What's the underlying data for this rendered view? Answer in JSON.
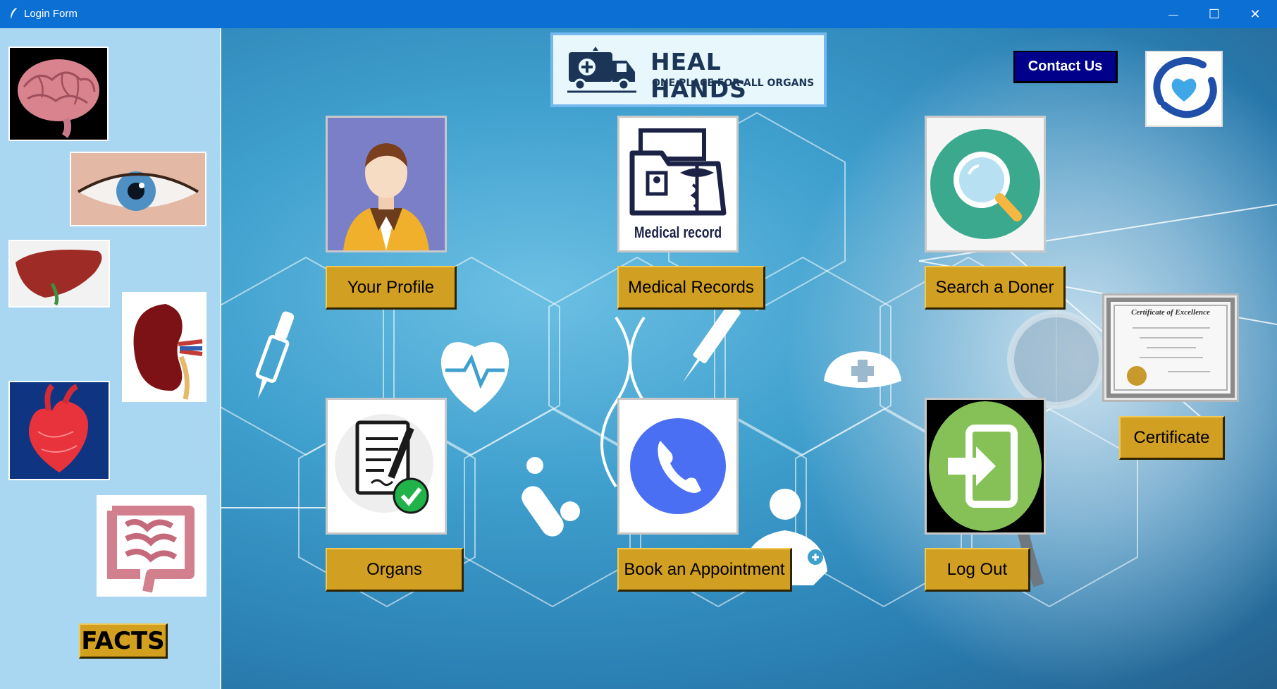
{
  "window": {
    "title": "Login Form",
    "minimize_glyph": "—",
    "maximize_glyph": "☐",
    "close_glyph": "✕"
  },
  "logo": {
    "title": "HEAL HANDS",
    "subtitle": "ONE PLACE FOR ALL ORGANS"
  },
  "header": {
    "contact_label": "Contact Us"
  },
  "sidebar": {
    "organs": [
      "brain",
      "eye",
      "liver",
      "kidney",
      "heart",
      "intestines"
    ],
    "facts_label": "FACTS"
  },
  "tiles": {
    "profile_label": "Your Profile",
    "records_label": "Medical Records",
    "records_caption": "Medical record",
    "search_label": "Search a Doner",
    "organs_label": "Organs",
    "appointment_label": "Book an Appointment",
    "logout_label": "Log Out",
    "certificate_label": "Certificate",
    "certificate_heading": "Certificate of Excellence"
  },
  "colors": {
    "titlebar": "#0b6fd3",
    "sidebar": "#a9d6f0",
    "button_gold": "#d19f22",
    "contact_navy": "#00008b"
  }
}
